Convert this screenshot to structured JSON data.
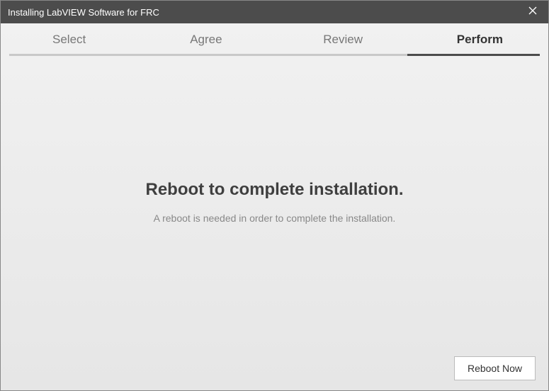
{
  "window": {
    "title": "Installing LabVIEW Software for FRC"
  },
  "tabs": {
    "items": [
      {
        "label": "Select",
        "active": false
      },
      {
        "label": "Agree",
        "active": false
      },
      {
        "label": "Review",
        "active": false
      },
      {
        "label": "Perform",
        "active": true
      }
    ]
  },
  "main": {
    "heading": "Reboot to complete installation.",
    "subtext": "A reboot is needed in order to complete the installation."
  },
  "footer": {
    "reboot_button": "Reboot Now"
  }
}
